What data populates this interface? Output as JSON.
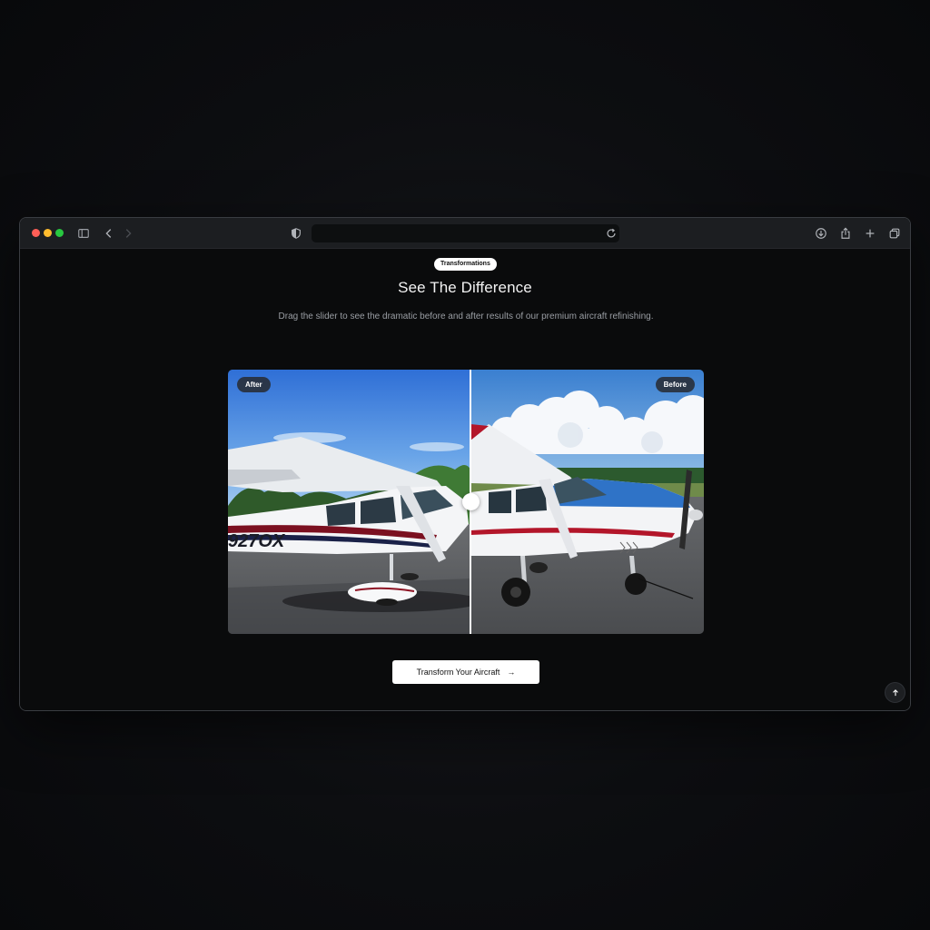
{
  "browser": {
    "toolbar_icons": [
      "sidebar-icon",
      "back-icon",
      "forward-icon",
      "shield-icon",
      "reload-icon",
      "download-icon",
      "share-icon",
      "new-tab-icon",
      "tabs-overview-icon"
    ],
    "url": ""
  },
  "section": {
    "tag": "Transformations",
    "title": "See The Difference",
    "subtitle": "Drag the slider to see the dramatic before and after results of our premium aircraft refinishing."
  },
  "comparison": {
    "after_label": "After",
    "before_label": "Before",
    "slider_position": 0.51
  },
  "cta": {
    "label": "Transform Your Aircraft",
    "icon": "arrow-right-icon"
  },
  "scroll_top": {
    "icon": "arrow-up-icon"
  },
  "colors": {
    "background": "#0a0b0c",
    "accent": "#ffffff",
    "stripe_after": "#9b1b2a",
    "stripe_before": "#b3162a",
    "paint_blue_before": "#2f73c7"
  }
}
